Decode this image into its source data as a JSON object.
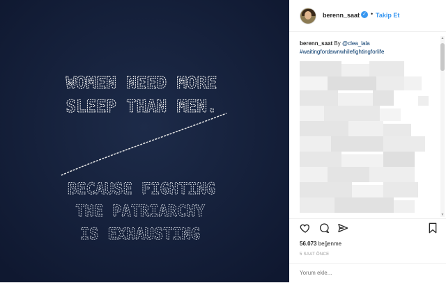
{
  "post": {
    "image_text": {
      "line1": "WOMEN NEED MORE",
      "line2": "SLEEP THAN MEN.",
      "line3": "BECAUSE FIGHTING",
      "line4": "THE PATRIARCHY",
      "line5": "IS EXHAUSTING"
    },
    "colors": {
      "image_bg": "#14203a",
      "accent": "#3897f0",
      "link": "#003569"
    }
  },
  "header": {
    "username": "berenn_saat",
    "separator": "•",
    "follow_label": "Takip Et"
  },
  "caption": {
    "username": "berenn_saat",
    "text": "By",
    "mention": "@clea_lala",
    "hashtag": "#waitingfordawnwhilefightingforlife"
  },
  "engagement": {
    "likes_count": "56.073",
    "likes_label": "beğenme",
    "time_ago": "5 SAAT ÖNCE"
  },
  "comment": {
    "placeholder": "Yorum ekle..."
  }
}
